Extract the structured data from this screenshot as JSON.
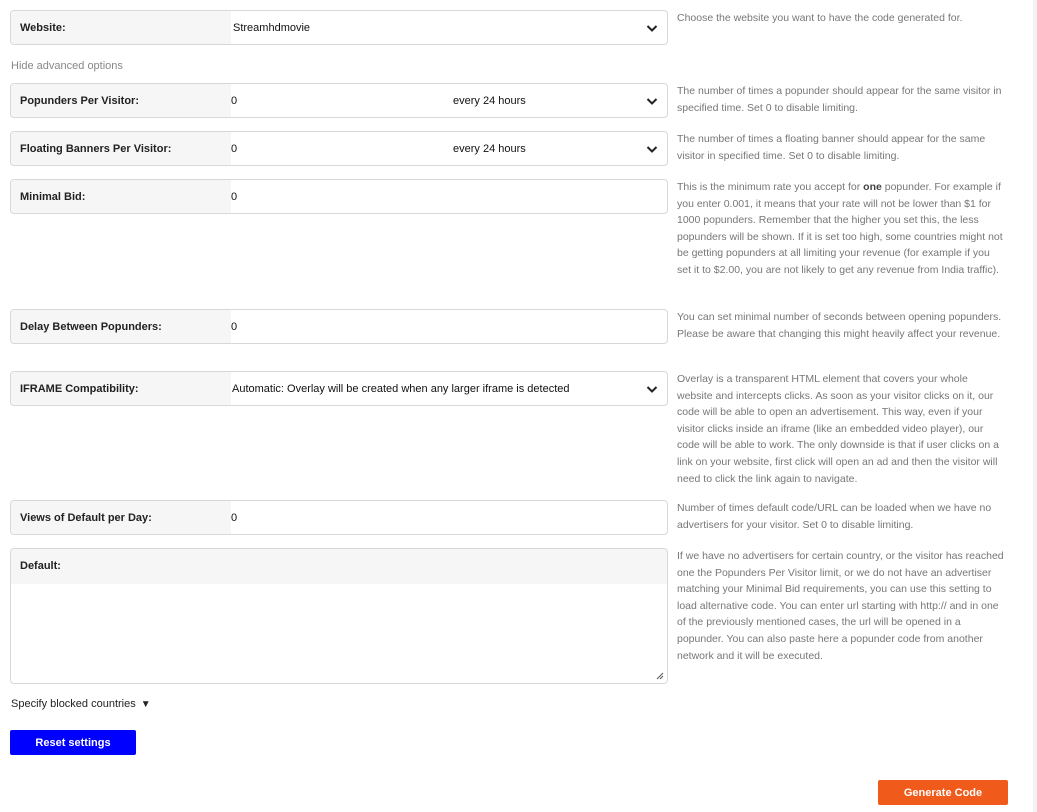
{
  "website": {
    "label": "Website:",
    "value": "Streamhdmovie",
    "help": "Choose the website you want to have the code generated for."
  },
  "advanced_toggle": "Hide advanced options",
  "popunders_per_visitor": {
    "label": "Popunders Per Visitor:",
    "value": "0",
    "period": "every 24 hours",
    "help": "The number of times a popunder should appear for the same visitor in specified time. Set 0 to disable limiting."
  },
  "floating_banners_per_visitor": {
    "label": "Floating Banners Per Visitor:",
    "value": "0",
    "period": "every 24 hours",
    "help": "The number of times a floating banner should appear for the same visitor in specified time. Set 0 to disable limiting."
  },
  "minimal_bid": {
    "label": "Minimal Bid:",
    "value": "0",
    "help_pre": "This is the minimum rate you accept for ",
    "help_bold": "one",
    "help_post": " popunder. For example if you enter 0.001, it means that your rate will not be lower than $1 for 1000 popunders. Remember that the higher you set this, the less popunders will be shown. If it is set too high, some countries might not be getting popunders at all limiting your revenue (for example if you set it to $2.00, you are not likely to get any revenue from India traffic)."
  },
  "delay_between_popunders": {
    "label": "Delay Between Popunders:",
    "value": "0",
    "help": "You can set minimal number of seconds between opening popunders. Please be aware that changing this might heavily affect your revenue."
  },
  "iframe_compatibility": {
    "label": "IFRAME Compatibility:",
    "value": "Automatic: Overlay will be created when any larger iframe is detected",
    "help": "Overlay is a transparent HTML element that covers your whole website and intercepts clicks. As soon as your visitor clicks on it, our code will be able to open an advertisement. This way, even if your visitor clicks inside an iframe (like an embedded video player), our code will be able to work. The only downside is that if user clicks on a link on your website, first click will open an ad and then the visitor will need to click the link again to navigate."
  },
  "views_of_default_per_day": {
    "label": "Views of Default per Day:",
    "value": "0",
    "help": "Number of times default code/URL can be loaded when we have no advertisers for your visitor. Set 0 to disable limiting."
  },
  "default": {
    "label": "Default:",
    "value": "",
    "help": "If we have no advertisers for certain country, or the visitor has reached one the Popunders Per Visitor limit, or we do not have an advertiser matching your Minimal Bid requirements, you can use this setting to load alternative code. You can enter url starting with http:// and in one of the previously mentioned cases, the url will be opened in a popunder. You can also paste here a popunder code from another network and it will be executed."
  },
  "blocked_countries_toggle": {
    "label": "Specify blocked countries",
    "arrow": "▼"
  },
  "reset_button": "Reset settings",
  "generate_button": "Generate Code",
  "colors": {
    "reset_bg": "#0000ff",
    "generate_bg": "#f05a1a"
  }
}
